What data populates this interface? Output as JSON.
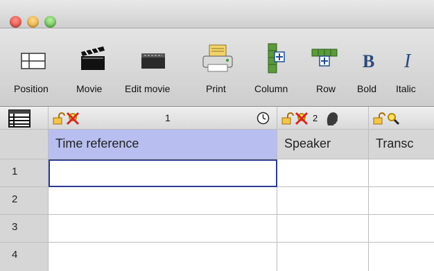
{
  "window": {
    "traffic_lights": [
      "close",
      "minimize",
      "zoom"
    ]
  },
  "toolbar": {
    "items": [
      {
        "label": "Position",
        "icon": "position-icon"
      },
      {
        "label": "Movie",
        "icon": "clapperboard-icon"
      },
      {
        "label": "Edit movie",
        "icon": "edit-movie-icon"
      },
      {
        "label": "Print",
        "icon": "printer-icon"
      },
      {
        "label": "Column",
        "icon": "add-column-icon"
      },
      {
        "label": "Row",
        "icon": "add-row-icon"
      },
      {
        "label": "Bold",
        "icon": "bold-icon"
      },
      {
        "label": "Italic",
        "icon": "italic-icon"
      }
    ],
    "bold_glyph": "B",
    "italic_glyph": "I"
  },
  "table": {
    "columns": [
      {
        "number": "1",
        "header": "Time reference",
        "lock_state": "unlocked-crossed"
      },
      {
        "number": "2",
        "header": "Speaker",
        "lock_state": "unlocked-crossed"
      },
      {
        "number": "",
        "header": "Transc",
        "lock_state": "unlocked-search"
      }
    ],
    "rows": [
      "1",
      "2",
      "3",
      "4"
    ],
    "selected_cell": {
      "row": "1",
      "column": "Time reference"
    }
  },
  "colors": {
    "selected_header": "#b8bff0",
    "selected_border": "#2c3a8f",
    "toolbar_bg": "#dcdcdc"
  }
}
